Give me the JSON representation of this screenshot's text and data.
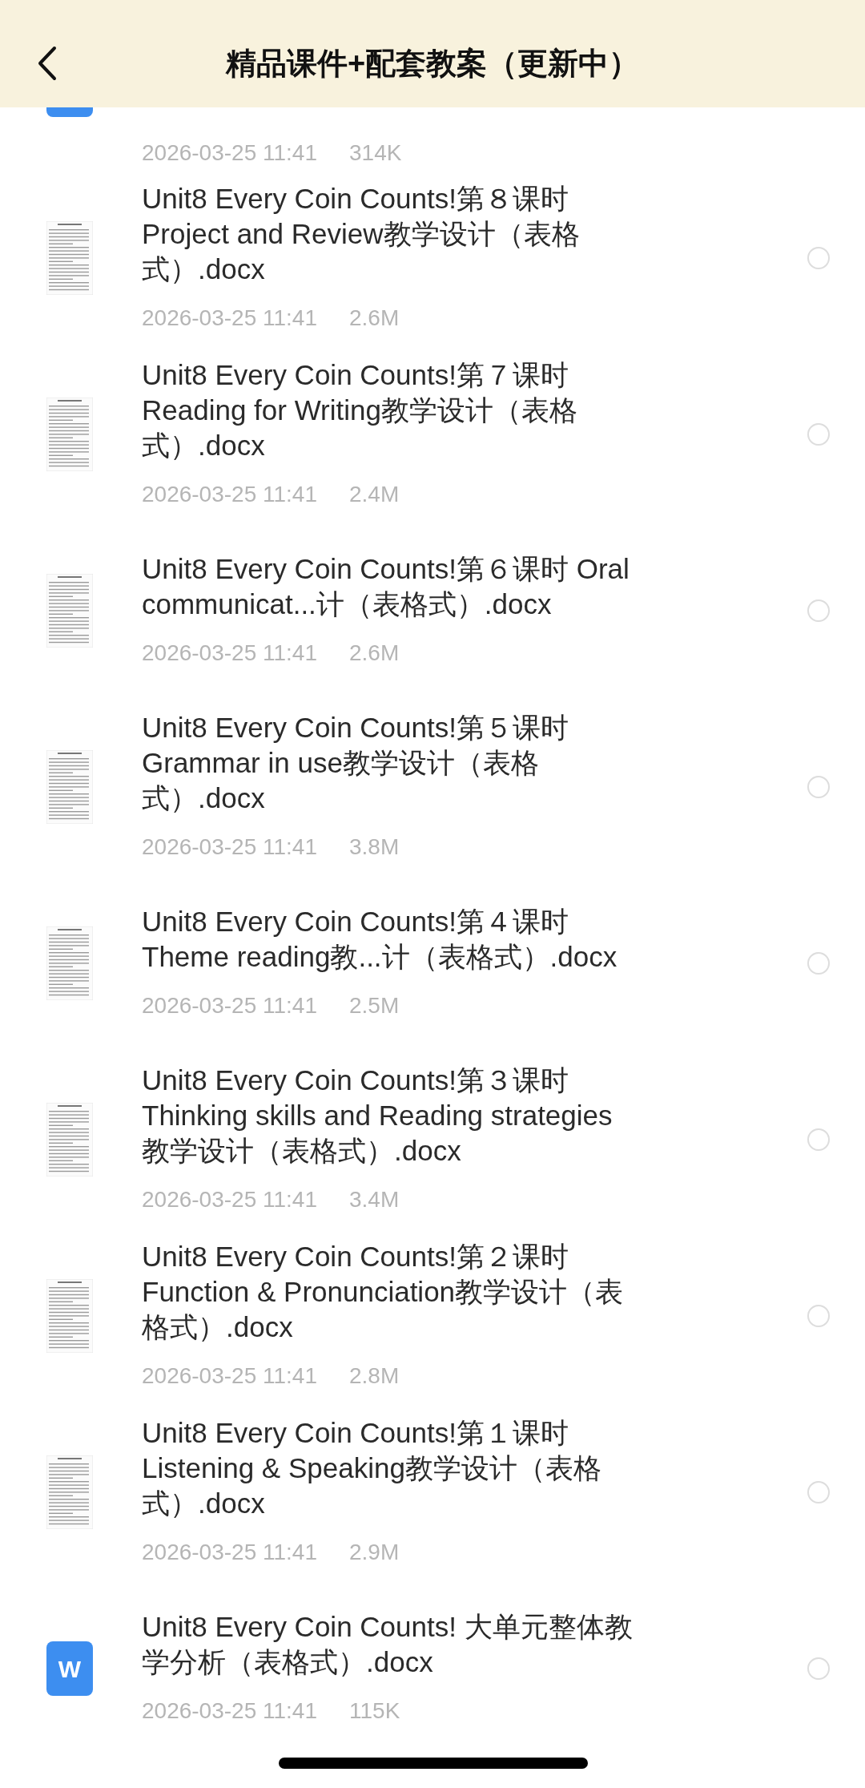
{
  "header": {
    "title": "精品课件+配套教案（更新中）"
  },
  "files": [
    {
      "kind": "word",
      "date": "2026-03-25 11:41",
      "size": "314K"
    },
    {
      "kind": "doc",
      "title": "Unit8 Every Coin Counts!第８课时 Project and Review教学设计（表格式）.docx",
      "date": "2026-03-25 11:41",
      "size": "2.6M",
      "selected": false
    },
    {
      "kind": "doc",
      "title": "Unit8 Every Coin Counts!第７课时 Reading for Writing教学设计（表格式）.docx",
      "date": "2026-03-25 11:41",
      "size": "2.4M",
      "selected": false
    },
    {
      "kind": "doc",
      "title": "Unit8 Every Coin Counts!第６课时 Oral communicat...计（表格式）.docx",
      "date": "2026-03-25 11:41",
      "size": "2.6M",
      "selected": false
    },
    {
      "kind": "doc",
      "title": "Unit8 Every Coin Counts!第５课时 Grammar in use教学设计（表格式）.docx",
      "date": "2026-03-25 11:41",
      "size": "3.8M",
      "selected": false
    },
    {
      "kind": "doc",
      "title": "Unit8 Every Coin Counts!第４课时 Theme reading教...计（表格式）.docx",
      "date": "2026-03-25 11:41",
      "size": "2.5M",
      "selected": false
    },
    {
      "kind": "doc",
      "title": "Unit8 Every Coin Counts!第３课时 Thinking skills and Reading strategies教学设计（表格式）.docx",
      "date": "2026-03-25 11:41",
      "size": "3.4M",
      "selected": false
    },
    {
      "kind": "doc",
      "title": "Unit8 Every Coin Counts!第２课时 Function & Pronunciation教学设计（表格式）.docx",
      "date": "2026-03-25 11:41",
      "size": "2.8M",
      "selected": false
    },
    {
      "kind": "doc",
      "title": "Unit8 Every Coin Counts!第１课时 Listening & Speaking教学设计（表格式）.docx",
      "date": "2026-03-25 11:41",
      "size": "2.9M",
      "selected": false
    },
    {
      "kind": "word",
      "icon_text": "W",
      "title": "Unit8 Every Coin Counts! 大单元整体教学分析（表格式）.docx",
      "date": "2026-03-25 11:41",
      "size": "115K",
      "selected": false
    }
  ]
}
